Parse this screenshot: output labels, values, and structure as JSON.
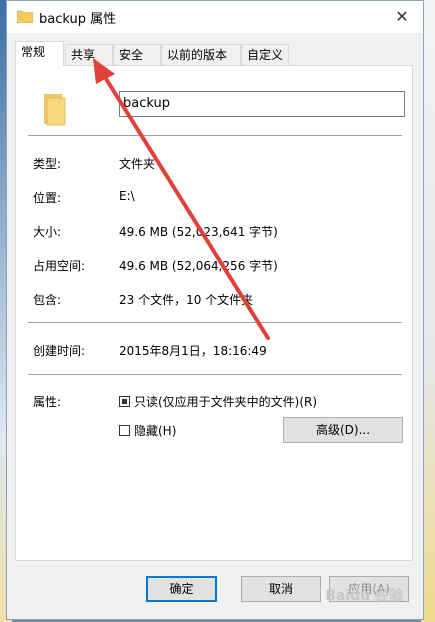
{
  "window": {
    "title": "backup 属性",
    "close_glyph": "✕"
  },
  "tabs": [
    {
      "label": "常规",
      "active": true
    },
    {
      "label": "共享",
      "active": false
    },
    {
      "label": "安全",
      "active": false
    },
    {
      "label": "以前的版本",
      "active": false
    },
    {
      "label": "自定义",
      "active": false
    }
  ],
  "general": {
    "name_value": "backup",
    "type_label": "类型:",
    "type_value": "文件夹",
    "location_label": "位置:",
    "location_value": "E:\\",
    "size_label": "大小:",
    "size_value": "49.6 MB (52,023,641 字节)",
    "disk_size_label": "占用空间:",
    "disk_size_value": "49.6 MB (52,064,256 字节)",
    "contains_label": "包含:",
    "contains_value": "23 个文件，10 个文件夹",
    "created_label": "创建时间:",
    "created_value": "2015年8月1日，18:16:49",
    "attributes_label": "属性:",
    "readonly_label": "只读(仅应用于文件夹中的文件)(R)",
    "readonly_checked": true,
    "hidden_label": "隐藏(H)",
    "hidden_checked": false,
    "advanced_button": "高级(D)..."
  },
  "footer": {
    "ok_button": "确定",
    "cancel_button": "取消",
    "apply_button": "应用(A)"
  },
  "watermark": "Baidu 经验",
  "colors": {
    "accent": "#0078d7",
    "arrow": "#e0413a",
    "folder": "#f5c85b"
  }
}
